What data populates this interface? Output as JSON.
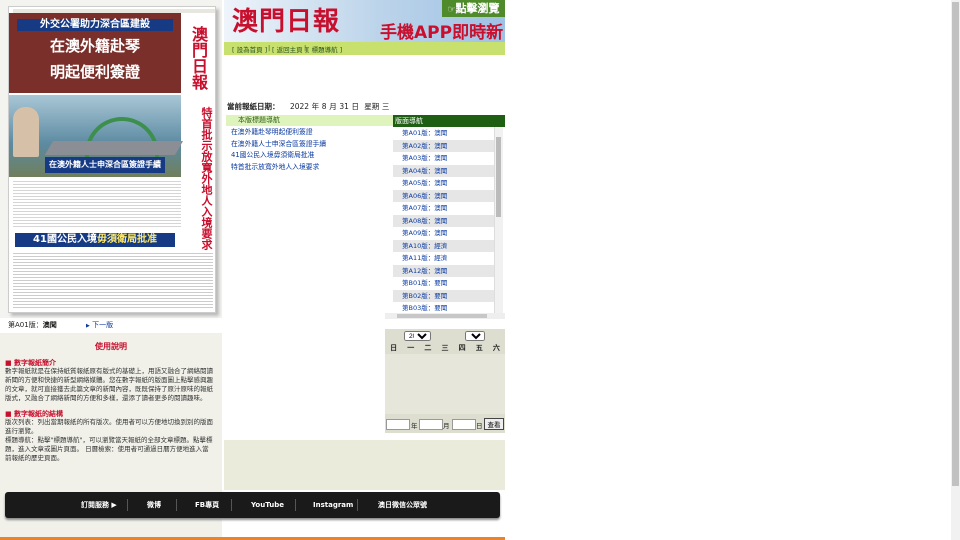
{
  "paper": {
    "top_banner": "外交公署助力深合區建設",
    "headline_1": "在澳外籍赴琴",
    "headline_2": "明起便利簽證",
    "masthead": "澳門日報",
    "photo_caption": "在澳外籍人士申深合區簽證手續",
    "vertical_headline": "特首批示放寬外地人入境要求",
    "bottom_headline_pre": "41國公民入境",
    "bottom_headline_em": "毋須衛局批准"
  },
  "page_label": {
    "prefix": "第A01版：",
    "name": "澳聞"
  },
  "next_link": "下一版",
  "help": {
    "title": "使用說明",
    "section1_title": "■ 數字報紙簡介",
    "section1_text": "數字報紙就是在保持紙質報紙原有版式的基礎上，用語又融合了網絡閱讀新聞的方便和快捷的新型網絡媒體。您在數字報紙的版面圖上點擊感興趣的文章，就可直接獲去此篇文章的新聞內容，既既保持了原汁原味的報紙版式，又融合了網絡新聞的方便和多樣，還添了讀者更多的閱讀趣味。",
    "section2_title": "■ 數字報紙的結構",
    "section2_text_1": "版次列表：列出當期報紙的所有版次。使用者可以方便地切換到別的版面進行瀏覽。",
    "section2_text_2": "標題導航：點擊\"標題導航\"，可以瀏覽當天報紙的全部文章標題。點擊標題，進入文章或圖片頁面。 日曆檢索：使用者可通過日曆方便地進入當前報紙的歷史頁面。"
  },
  "banner": {
    "logo": "澳門日報",
    "app_title": "手機APP即時新聞",
    "view_button": "點擊瀏覽"
  },
  "nav": {
    "set_home": "[ 設為首頁 ]",
    "back_home": "[ 返回主頁 ]",
    "headline_nav": "[ 標題導航 ]"
  },
  "date": {
    "label": "當前報紙日期：",
    "year": "2022",
    "month": "8",
    "day": "31",
    "weekday": "三",
    "year_unit": "年",
    "month_unit": "月",
    "day_unit": "日",
    "weekday_label": "星期"
  },
  "headline_nav": {
    "header": "本版標題導航",
    "items": [
      "在澳外籍赴琴明起便利簽證",
      "在澳外籍人士申深合區簽證手續",
      "41國公民入境毋須衛局批准",
      "特首批示放寬外地人入境要求"
    ]
  },
  "edition_nav": {
    "header": "版面導航",
    "items": [
      "第A01版：澳聞",
      "第A02版：澳聞",
      "第A03版：澳聞",
      "第A04版：澳聞",
      "第A05版：澳聞",
      "第A06版：澳聞",
      "第A07版：澳聞",
      "第A08版：澳聞",
      "第A09版：澳聞",
      "第A10版：經濟",
      "第A11版：經濟",
      "第A12版：澳聞",
      "第B01版：要聞",
      "第B02版：要聞",
      "第B03版：要聞"
    ]
  },
  "calendar": {
    "year_select": "2006",
    "month_select": "1",
    "weekdays": [
      "日",
      "一",
      "二",
      "三",
      "四",
      "五",
      "六"
    ],
    "year_label": "年",
    "month_label": "月",
    "day_label": "日",
    "search_button": "查看"
  },
  "footer": {
    "links": [
      "訂閱服務 ▶",
      "微博",
      "FB專頁",
      "YouTube",
      "Instagram",
      "澳日微信公眾號"
    ]
  }
}
